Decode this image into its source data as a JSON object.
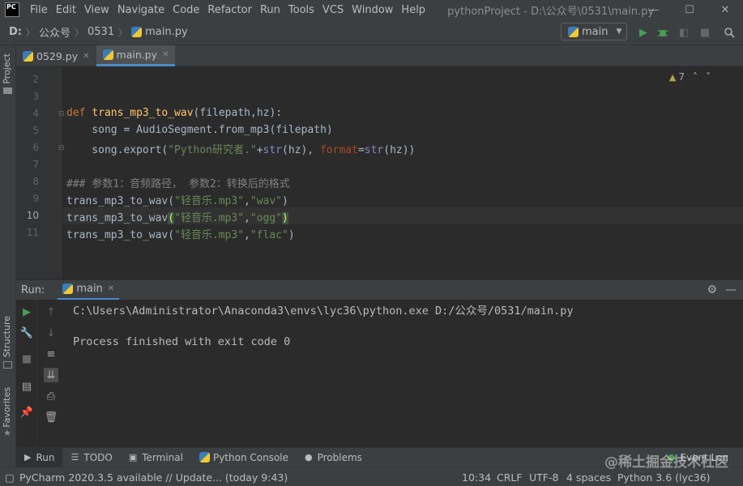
{
  "app": {
    "logo": "PC",
    "title": "pythonProject - D:\\公众号\\0531\\main.py"
  },
  "menu": [
    "File",
    "Edit",
    "View",
    "Navigate",
    "Code",
    "Refactor",
    "Run",
    "Tools",
    "VCS",
    "Window",
    "Help"
  ],
  "window_controls": {
    "minimize": "—",
    "maximize": "☐",
    "close": "✕"
  },
  "breadcrumb": [
    "D:",
    "公众号",
    "0531",
    "main.py"
  ],
  "run_config": {
    "label": "main"
  },
  "tool_windows_left": {
    "project": "Project",
    "structure": "Structure",
    "favorites": "Favorites"
  },
  "editor_tabs": [
    {
      "label": "0529.py"
    },
    {
      "label": "main.py"
    }
  ],
  "inspections": {
    "warning_count": "7"
  },
  "line_numbers": [
    "2",
    "3",
    "4",
    "5",
    "6",
    "7",
    "8",
    "9",
    "10",
    "11"
  ],
  "code": {
    "l4_def": "def",
    "l4_fn": "trans_mp3_to_wav",
    "l4_params": "(filepath,hz):",
    "l5": "    song = AudioSegment.from_mp3(filepath)",
    "l6_a": "    song.export(",
    "l6_str": "\"Python研究者.\"",
    "l6_b": "+",
    "l6_str_fn": "str",
    "l6_c": "(hz), ",
    "l6_kw": "format",
    "l6_d": "=",
    "l6_str_fn2": "str",
    "l6_e": "(hz))",
    "l8_comment": "### 参数1：音频路径， 参数2：转换后的格式",
    "l9_call": "trans_mp3_to_wav(",
    "l9_s1": "\"轻音乐.mp3\"",
    "l9_comma": ",",
    "l9_s2": "\"wav\"",
    "l9_close": ")",
    "l10_call": "trans_mp3_to_wav",
    "l10_open": "(",
    "l10_s1": "\"轻音乐.mp3\"",
    "l10_comma": ",",
    "l10_s2": "\"ogg\"",
    "l10_close": ")",
    "l11_call": "trans_mp3_to_wav(",
    "l11_s1": "\"轻音乐.mp3\"",
    "l11_comma": ",",
    "l11_s2": "\"flac\"",
    "l11_close": ")"
  },
  "run_panel": {
    "title": "Run:",
    "tab_label": "main",
    "console_lines": [
      "C:\\Users\\Administrator\\Anaconda3\\envs\\lyc36\\python.exe D:/公众号/0531/main.py",
      "",
      "Process finished with exit code 0"
    ]
  },
  "bottom_tabs": [
    {
      "label": "Run",
      "icon": "play-icon"
    },
    {
      "label": "TODO",
      "icon": "list-icon"
    },
    {
      "label": "Terminal",
      "icon": "terminal-icon"
    },
    {
      "label": "Python Console",
      "icon": "python-icon"
    },
    {
      "label": "Problems",
      "icon": "info-icon"
    }
  ],
  "event_log": "Event Log",
  "status_bar": {
    "update": "PyCharm 2020.3.5 available // Update... (today 9:43)",
    "position": "10:34",
    "line_sep": "CRLF",
    "encoding": "UTF-8",
    "indent": "4 spaces",
    "interpreter": "Python 3.6 (lyc36)"
  },
  "watermark": "@稀土掘金技术社区",
  "colors": {
    "background": "#2b2b2b",
    "panel": "#3c3f41",
    "keyword": "#cc7832",
    "function": "#ffc66d",
    "string": "#6a8759",
    "run_green": "#499c54",
    "accent": "#4a88c7"
  }
}
